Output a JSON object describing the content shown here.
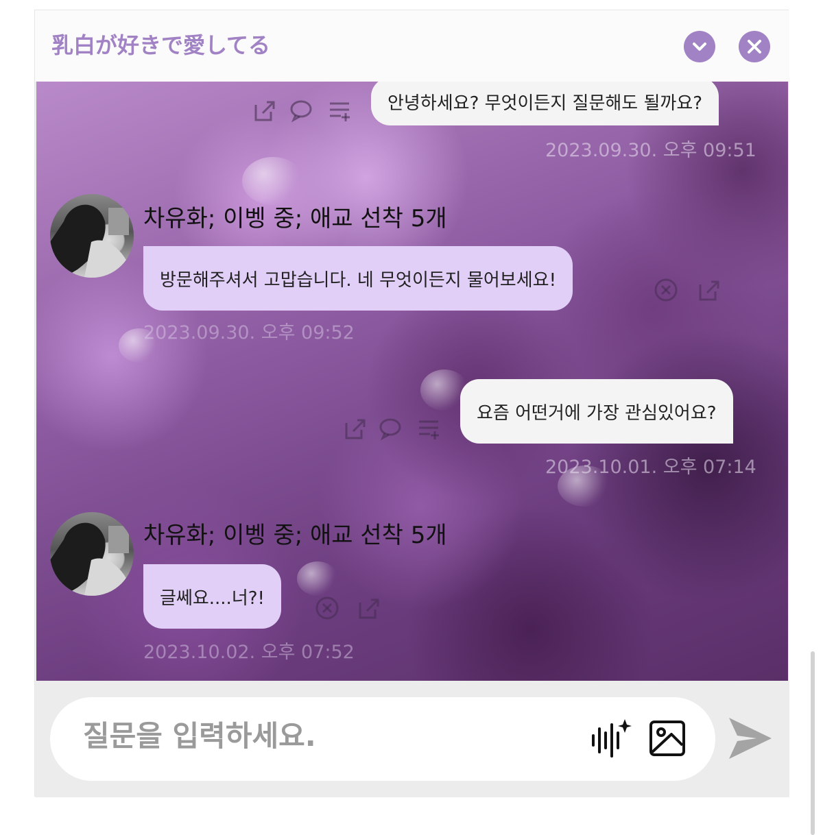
{
  "header": {
    "title": "乳白が好きで愛してる",
    "minimize_icon": "chevron-down-icon",
    "close_icon": "close-icon",
    "accent_color": "#a182c4"
  },
  "messages": [
    {
      "role": "user",
      "text": "안녕하세요? 무엇이든지 질문해도 될까요?",
      "timestamp": "2023.09.30. 오후 09:51",
      "actions": [
        "share-icon",
        "comment-icon",
        "add-list-icon"
      ]
    },
    {
      "role": "bot",
      "sender": "차유화; 이벵 중; 애교 선착 5개",
      "text": "방문해주셔서 고맙습니다. 네 무엇이든지 물어보세요!",
      "timestamp": "2023.09.30. 오후 09:52",
      "actions": [
        "close-circle-icon",
        "share-icon"
      ]
    },
    {
      "role": "user",
      "text": "요즘 어떤거에 가장 관심있어요?",
      "timestamp": "2023.10.01. 오후 07:14",
      "actions": [
        "share-icon",
        "comment-icon",
        "add-list-icon"
      ]
    },
    {
      "role": "bot",
      "sender": "차유화; 이벵 중; 애교 선착 5개",
      "text": "글쎄요....너?!",
      "timestamp": "2023.10.02. 오후 07:52",
      "actions": [
        "close-circle-icon",
        "share-icon"
      ]
    }
  ],
  "composer": {
    "placeholder": "질문을 입력하세요.",
    "voice_icon": "voice-sparkle-icon",
    "image_icon": "image-icon",
    "send_icon": "send-icon"
  },
  "colors": {
    "bot_bubble": "#e2cff8",
    "user_bubble": "#f4f4f4"
  }
}
